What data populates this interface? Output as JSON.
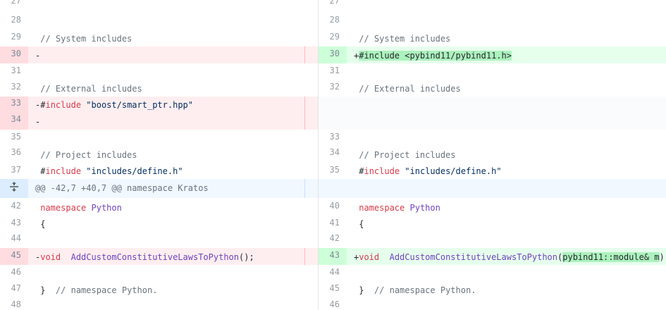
{
  "left": {
    "l27": {
      "num": "27"
    },
    "l28": {
      "num": "28"
    },
    "l29": {
      "num": "29",
      "comment": "// System includes"
    },
    "l30": {
      "num": "30",
      "marker": "-"
    },
    "l31": {
      "num": "31"
    },
    "l32": {
      "num": "32",
      "comment": "// External includes"
    },
    "l33": {
      "num": "33",
      "marker": "-",
      "hash": "#",
      "kw": "include",
      "str": "\"boost/smart_ptr.hpp\""
    },
    "l34": {
      "num": "34",
      "marker": "-"
    },
    "l35": {
      "num": "35"
    },
    "l36": {
      "num": "36",
      "comment": "// Project includes"
    },
    "l37": {
      "num": "37",
      "hash": "#",
      "kw": "include",
      "str": "\"includes/define.h\""
    },
    "l42": {
      "num": "42",
      "kw": "namespace",
      "ent": "Python"
    },
    "l43": {
      "num": "43",
      "text": "{"
    },
    "l44": {
      "num": "44"
    },
    "l45": {
      "num": "45",
      "marker": "-",
      "kw": "void",
      "ent": "AddCustomConstitutiveLawsToPython",
      "rest": "();"
    },
    "l46": {
      "num": "46"
    },
    "l47": {
      "num": "47",
      "text": "}",
      "comment": "// namespace Python."
    },
    "l48": {
      "num": "48"
    }
  },
  "hunk": {
    "text": "@@ -42,7 +40,7 @@ namespace Kratos"
  },
  "right": {
    "r27": {
      "num": "27"
    },
    "r28": {
      "num": "28"
    },
    "r29": {
      "num": "29",
      "comment": "// System includes"
    },
    "r30": {
      "num": "30",
      "marker": "+",
      "hl": "#include <pybind11/pybind11.h>"
    },
    "r31": {
      "num": "31"
    },
    "r32": {
      "num": "32",
      "comment": "// External includes"
    },
    "r33": {
      "num": "33"
    },
    "r34": {
      "num": "34",
      "comment": "// Project includes"
    },
    "r35": {
      "num": "35",
      "hash": "#",
      "kw": "include",
      "str": "\"includes/define.h\""
    },
    "r40": {
      "num": "40",
      "kw": "namespace",
      "ent": "Python"
    },
    "r41": {
      "num": "41",
      "text": "{"
    },
    "r42": {
      "num": "42"
    },
    "r43": {
      "num": "43",
      "marker": "+",
      "kw": "void",
      "ent": "AddCustomConstitutiveLawsToPython",
      "p1": "(",
      "hl": "pybind11::module& m",
      "p2": ");"
    },
    "r44": {
      "num": "44"
    },
    "r45": {
      "num": "45",
      "text": "}",
      "comment": "// namespace Python."
    },
    "r46": {
      "num": "46"
    }
  },
  "colors": {
    "deletion": "#ffeef0",
    "addition": "#e6ffed",
    "hunk": "#f1f8ff",
    "highlight": "#acf2bd"
  }
}
